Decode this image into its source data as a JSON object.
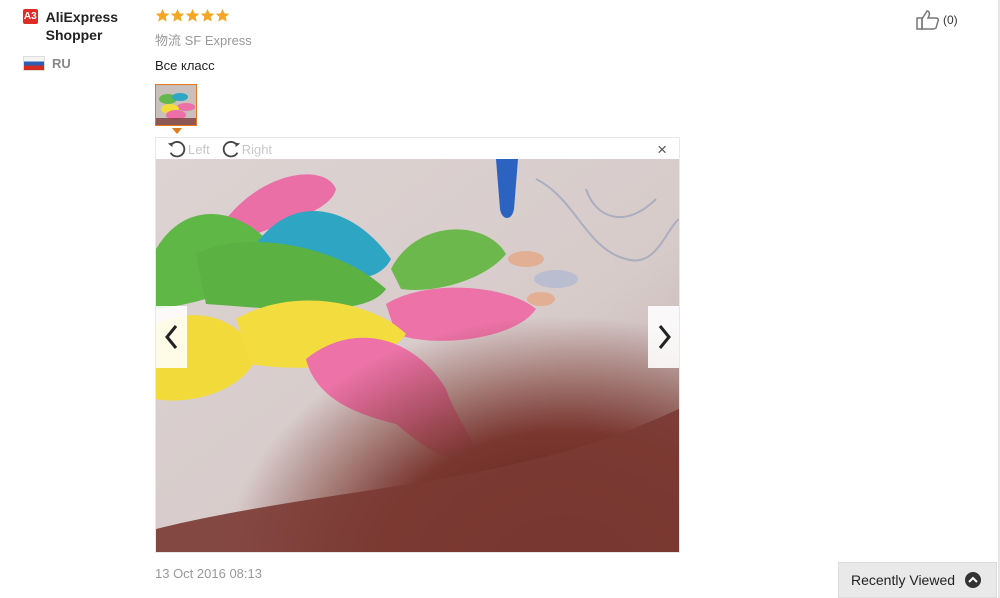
{
  "reviewer": {
    "level_badge": "A3",
    "name": "AliExpress Shopper",
    "country": "RU"
  },
  "review": {
    "rating_stars": 5,
    "shipping": "物流 SF Express",
    "text": "Все класс",
    "date": "13 Oct 2016 08:13"
  },
  "viewer": {
    "rotate_left_label": "Left",
    "rotate_right_label": "Right",
    "close_label": "×"
  },
  "helpful": {
    "count": "(0)"
  },
  "recently_viewed": {
    "label": "Recently Viewed"
  },
  "colors": {
    "star": "#f5a623",
    "accent": "#e07a1f",
    "badge": "#e02b27"
  }
}
